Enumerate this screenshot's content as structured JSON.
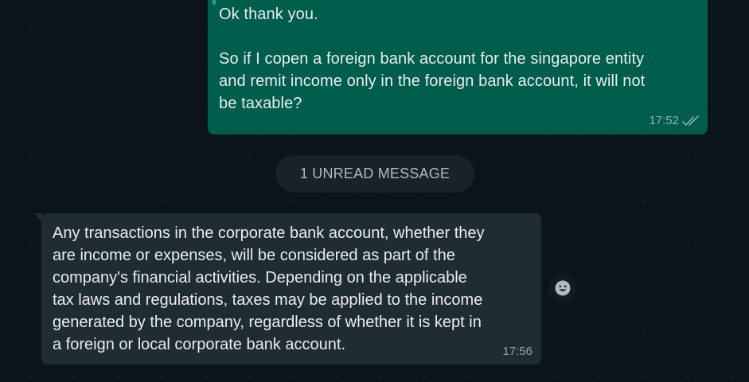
{
  "outgoing": {
    "lines": [
      "Ok thank you.",
      "So if I copen a foreign bank account for the singapore entity",
      "and remit income only in the foreign bank account, it will not",
      "be taxable?"
    ],
    "time": "17:52",
    "status_icon": "double-check-icon"
  },
  "unread_divider": {
    "label": "1 UNREAD MESSAGE"
  },
  "incoming": {
    "lines": [
      "Any transactions in the corporate bank account, whether they",
      "are income or expenses, will be considered as part of the",
      "company's financial activities. Depending on the applicable",
      "tax laws and regulations, taxes may be applied to the income",
      "generated by the company, regardless of whether it is kept in",
      "a foreign or local corporate bank account."
    ],
    "time": "17:56"
  },
  "reaction_button": {
    "icon": "smiley-icon"
  },
  "colors": {
    "background": "#0b141a",
    "outgoing_bubble": "#005c4b",
    "incoming_bubble": "#202c33",
    "pill": "#182229",
    "text": "#e9edef"
  }
}
